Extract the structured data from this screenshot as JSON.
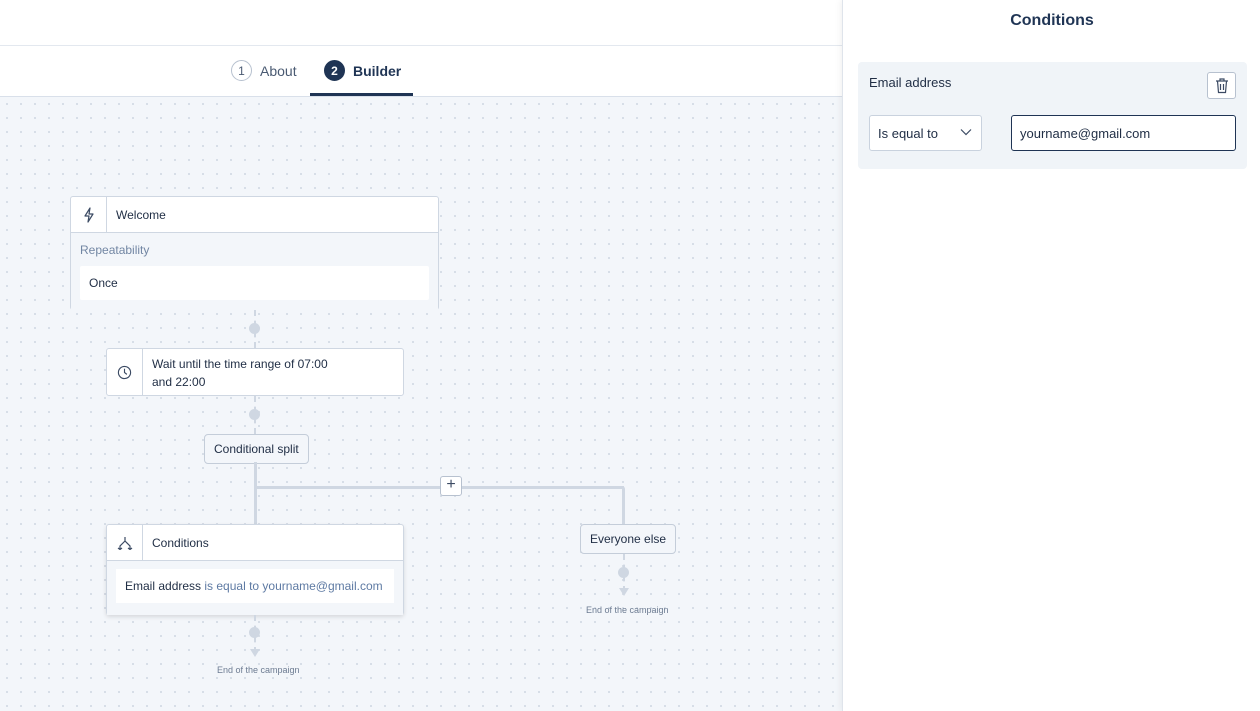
{
  "steps": [
    {
      "num": "1",
      "label": "About"
    },
    {
      "num": "2",
      "label": "Builder"
    }
  ],
  "flow": {
    "trigger": {
      "title": "Welcome",
      "icon": "lightning-icon",
      "repeat_label": "Repeatability",
      "repeat_value": "Once"
    },
    "wait": {
      "icon": "clock-icon",
      "text": "Wait until the time range of 07:00 and 22:00"
    },
    "split_label": "Conditional split",
    "branch": {
      "title": "Conditions",
      "icon": "split-icon",
      "field": "Email address",
      "op_text": "is equal to",
      "value": "yourname@gmail.com",
      "end_text": "End of the campaign"
    },
    "else_branch": {
      "label": "Everyone else",
      "end_text": "End of the campaign"
    },
    "add_button": "+"
  },
  "panel": {
    "title": "Conditions",
    "condition": {
      "field_label": "Email address",
      "operator": "Is equal to",
      "value": "yourname@gmail.com"
    }
  },
  "colors": {
    "accent": "#1f3454",
    "canvas": "#f3f6fa",
    "connector": "#cfd7e2"
  }
}
